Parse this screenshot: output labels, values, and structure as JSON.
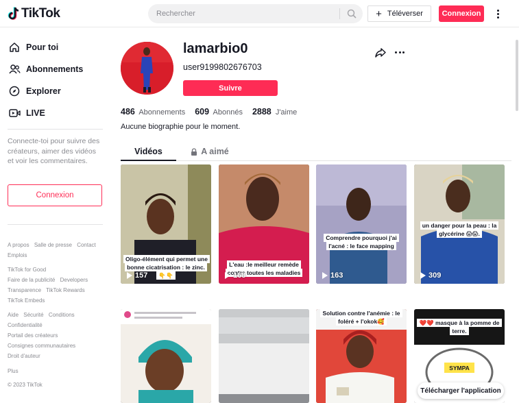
{
  "header": {
    "logo_text": "TikTok",
    "search_placeholder": "Rechercher",
    "upload_label": "Téléverser",
    "login_label": "Connexion"
  },
  "sidebar": {
    "nav": [
      {
        "label": "Pour toi",
        "icon": "home-icon",
        "active": true
      },
      {
        "label": "Abonnements",
        "icon": "people-icon"
      },
      {
        "label": "Explorer",
        "icon": "compass-icon"
      },
      {
        "label": "LIVE",
        "icon": "live-icon"
      }
    ],
    "hint": "Connecte-toi pour suivre des créateurs, aimer des vidéos et voir les commentaires.",
    "login_label": "Connexion",
    "footer": {
      "row1": [
        "A propos",
        "Salle de presse",
        "Contact"
      ],
      "row2": [
        "Emplois"
      ],
      "row3": [
        "TikTok for Good"
      ],
      "row4": [
        "Faire de la publicité",
        "Developers"
      ],
      "row5": [
        "Transparence",
        "TikTok Rewards"
      ],
      "row6": [
        "TikTok Embeds"
      ],
      "row7": [
        "Aide",
        "Sécurité",
        "Conditions"
      ],
      "row8": [
        "Confidentialité"
      ],
      "row9": [
        "Portail des créateurs"
      ],
      "row10": [
        "Consignes communautaires"
      ],
      "row11": [
        "Droit d'auteur"
      ],
      "more": "Plus",
      "copyright": "© 2023 TikTok"
    }
  },
  "profile": {
    "name": "lamarbio0",
    "handle": "user9199802676703",
    "follow_label": "Suivre",
    "stats": {
      "following_count": "486",
      "following_label": "Abonnements",
      "followers_count": "609",
      "followers_label": "Abonnés",
      "likes_count": "2888",
      "likes_label": "J'aime"
    },
    "bio": "Aucune biographie pour le moment."
  },
  "tabs": {
    "videos": "Vidéos",
    "liked": "A aimé"
  },
  "videos": [
    {
      "caption": "Oligo-élément qui permet une bonne cicatrisation : le zinc.👇👇",
      "plays": "157"
    },
    {
      "caption": "L'eau :le meilleur remède contre toutes les maladies",
      "plays": "168"
    },
    {
      "caption": "Comprendre pourquoi j'ai l'acné : le face mapping",
      "plays": "163"
    },
    {
      "caption": "un danger pour la peau : la glycérine 😱😱.",
      "plays": "309"
    },
    {
      "caption": "",
      "plays": ""
    },
    {
      "caption": "",
      "plays": ""
    },
    {
      "caption": "Solution contre l'anémie : le foléré + l'okok🥰",
      "plays": ""
    },
    {
      "caption": "❤️❤️ masque à la pomme de terre.",
      "badge": "SYMPA",
      "plays": ""
    }
  ],
  "get_app_label": "Télécharger l'application",
  "colors": {
    "accent": "#fe2c55",
    "text": "#161823",
    "muted": "#8a8b91"
  }
}
